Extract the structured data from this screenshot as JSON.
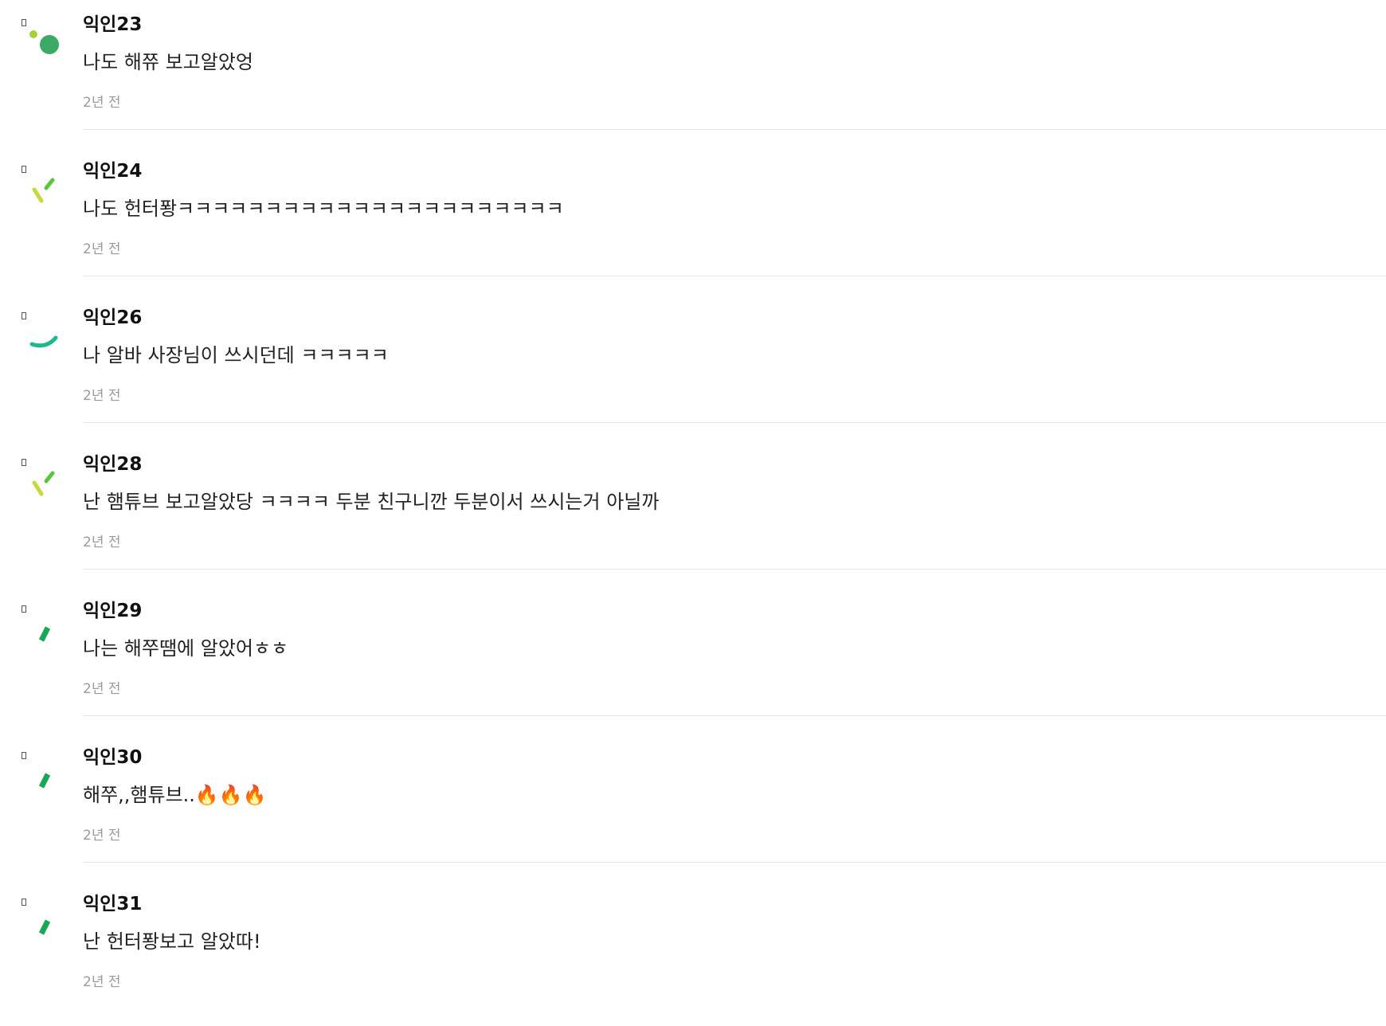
{
  "comments": [
    {
      "author": "익인23",
      "text": "나도 해쮸 보고알았엉",
      "time": "2년 전",
      "avatar_icon": "dot-pair-icon",
      "avatar_colors": [
        "#a6cf3e",
        "#3aaa66"
      ]
    },
    {
      "author": "익인24",
      "text": "나도 헌터퐝ㅋㅋㅋㅋㅋㅋㅋㅋㅋㅋㅋㅋㅋㅋㅋㅋㅋㅋㅋㅋㅋㅋ",
      "time": "2년 전",
      "avatar_icon": "check-dashes-icon",
      "avatar_colors": [
        "#c9d83b",
        "#5ac63a"
      ]
    },
    {
      "author": "익인26",
      "text": "나 알바 사장님이 쓰시던데 ㅋㅋㅋㅋㅋ",
      "time": "2년 전",
      "avatar_icon": "smile-arc-icon",
      "avatar_colors": [
        "#1bb98c"
      ]
    },
    {
      "author": "익인28",
      "text": "난 햄튜브 보고알았당 ㅋㅋㅋㅋ 두분 친구니깐 두분이서 쓰시는거 아닐까",
      "time": "2년 전",
      "avatar_icon": "check-dashes-icon",
      "avatar_colors": [
        "#c9d83b",
        "#5ac63a"
      ]
    },
    {
      "author": "익인29",
      "text": "나는 해쭈땜에 알았어ㅎㅎ",
      "time": "2년 전",
      "avatar_icon": "slash-icon",
      "avatar_colors": [
        "#1aa65a"
      ]
    },
    {
      "author": "익인30",
      "text": "해쭈,,햄튜브..🔥🔥🔥",
      "time": "2년 전",
      "avatar_icon": "slash-icon",
      "avatar_colors": [
        "#1aa65a"
      ]
    },
    {
      "author": "익인31",
      "text": "난 헌터퐝보고 알았따!",
      "time": "2년 전",
      "avatar_icon": "slash-icon",
      "avatar_colors": [
        "#1aa65a"
      ]
    }
  ]
}
